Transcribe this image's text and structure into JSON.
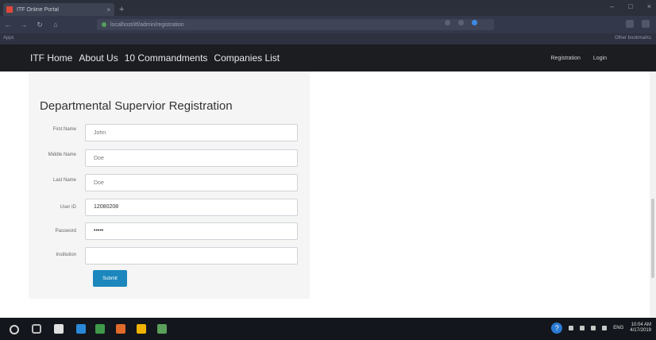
{
  "browser": {
    "tab_title": "ITF Online Portal",
    "url": "localhost/itf/admin/registration",
    "bookmark_left": "Apps",
    "bookmark_right": "Other bookmarks"
  },
  "site_nav": {
    "links": [
      "ITF Home",
      "About Us",
      "10 Commandments",
      "Companies List"
    ],
    "right": [
      "Registration",
      "Login"
    ]
  },
  "form": {
    "title": "Departmental Supervior Registration",
    "fields": [
      {
        "label": "First Name",
        "value": "",
        "placeholder": "John"
      },
      {
        "label": "Middle Name",
        "value": "",
        "placeholder": "Doe"
      },
      {
        "label": "Last Name",
        "value": "",
        "placeholder": "Doe"
      },
      {
        "label": "User ID",
        "value": "12080208",
        "placeholder": ""
      },
      {
        "label": "Password",
        "value": "•••••",
        "placeholder": ""
      },
      {
        "label": "Institution",
        "value": "",
        "placeholder": ""
      }
    ],
    "submit_label": "Submit"
  },
  "taskbar": {
    "clock_time": "10:04 AM",
    "clock_date": "4/17/2019",
    "lang": "ENG"
  },
  "colors": {
    "navbar": "#1c1d21",
    "submit": "#1b87bd",
    "panel": "#f5f5f5"
  }
}
